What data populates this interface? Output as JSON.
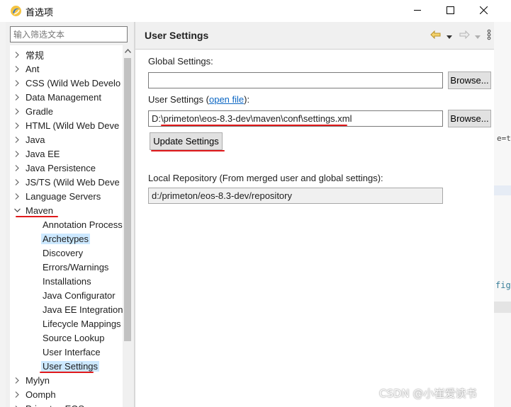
{
  "window": {
    "title": "首选项",
    "minimize_icon": "minimize-icon",
    "maximize_icon": "maximize-icon",
    "close_icon": "close-icon"
  },
  "filter": {
    "placeholder": "输入筛选文本"
  },
  "tree": {
    "items": [
      {
        "label": "常规",
        "indent": 0,
        "chevron": "right"
      },
      {
        "label": "Ant",
        "indent": 0,
        "chevron": "right"
      },
      {
        "label": "CSS (Wild Web Develo",
        "indent": 0,
        "chevron": "right"
      },
      {
        "label": "Data Management",
        "indent": 0,
        "chevron": "right"
      },
      {
        "label": "Gradle",
        "indent": 0,
        "chevron": "right"
      },
      {
        "label": "HTML (Wild Web Deve",
        "indent": 0,
        "chevron": "right"
      },
      {
        "label": "Java",
        "indent": 0,
        "chevron": "right"
      },
      {
        "label": "Java EE",
        "indent": 0,
        "chevron": "right"
      },
      {
        "label": "Java Persistence",
        "indent": 0,
        "chevron": "right"
      },
      {
        "label": "JS/TS (Wild Web Deve",
        "indent": 0,
        "chevron": "right"
      },
      {
        "label": "Language Servers",
        "indent": 0,
        "chevron": "right"
      },
      {
        "label": "Maven",
        "indent": 0,
        "chevron": "down"
      },
      {
        "label": "Annotation Process",
        "indent": 1,
        "chevron": ""
      },
      {
        "label": "Archetypes",
        "indent": 1,
        "chevron": "",
        "highlight": true
      },
      {
        "label": "Discovery",
        "indent": 1,
        "chevron": ""
      },
      {
        "label": "Errors/Warnings",
        "indent": 1,
        "chevron": ""
      },
      {
        "label": "Installations",
        "indent": 1,
        "chevron": ""
      },
      {
        "label": "Java Configurator",
        "indent": 1,
        "chevron": ""
      },
      {
        "label": "Java EE Integration",
        "indent": 1,
        "chevron": ""
      },
      {
        "label": "Lifecycle Mappings",
        "indent": 1,
        "chevron": ""
      },
      {
        "label": "Source Lookup",
        "indent": 1,
        "chevron": ""
      },
      {
        "label": "User Interface",
        "indent": 1,
        "chevron": ""
      },
      {
        "label": "User Settings",
        "indent": 1,
        "chevron": "",
        "selected": true
      },
      {
        "label": "Mylyn",
        "indent": 0,
        "chevron": "right"
      },
      {
        "label": "Oomph",
        "indent": 0,
        "chevron": "right"
      },
      {
        "label": "Primeton EOS",
        "indent": 0,
        "chevron": "right"
      }
    ]
  },
  "page": {
    "title": "User Settings",
    "back_icon": "back-arrow-icon",
    "forward_icon": "forward-arrow-icon",
    "menu_icon": "more-vertical-icon",
    "global_settings_label": "Global Settings:",
    "global_settings_value": "",
    "browse_label": "Browse...",
    "user_settings_label": "User Settings (",
    "open_file_link": "open file",
    "user_settings_label_end": "):",
    "user_settings_value": "D:\\primeton\\eos-8.3-dev\\maven\\conf\\settings.xml",
    "update_settings_label": "Update Settings",
    "local_repo_label": "Local Repository (From merged user and global settings):",
    "local_repo_value": "d:/primeton/eos-8.3-dev/repository"
  },
  "background": {
    "fragment_1": "e=t",
    "fragment_2": "fig"
  },
  "watermark": "CSDN @小崔爱读书",
  "colors": {
    "annotation_red": "#e0191b",
    "selection": "#cce8ff",
    "link": "#0b66c3"
  }
}
